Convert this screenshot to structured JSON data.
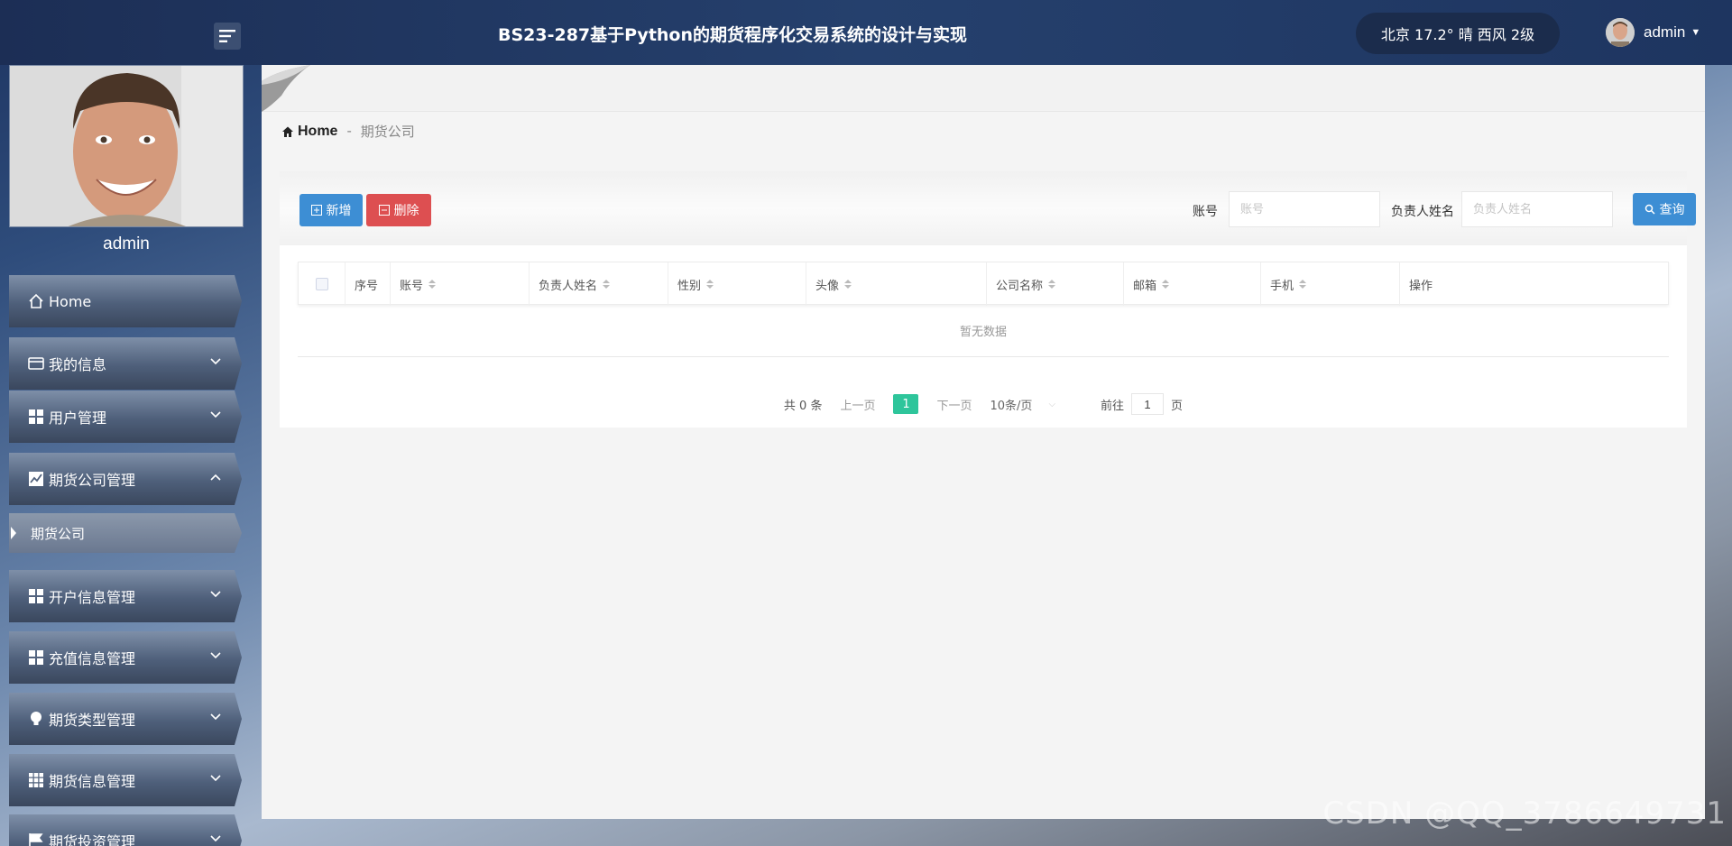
{
  "header": {
    "title": "BS23-287基于Python的期货程序化交易系统的设计与实现",
    "weather": "北京 17.2° 晴 西风 2级",
    "username": "admin"
  },
  "sidebar": {
    "profile_name": "admin",
    "items": [
      {
        "label": "Home",
        "icon": "home-icon"
      },
      {
        "label": "我的信息",
        "icon": "id-card-icon"
      },
      {
        "label": "用户管理",
        "icon": "grid-icon"
      },
      {
        "label": "期货公司管理",
        "icon": "chart-icon",
        "expanded": true
      },
      {
        "label": "开户信息管理",
        "icon": "grid-icon"
      },
      {
        "label": "充值信息管理",
        "icon": "grid-icon"
      },
      {
        "label": "期货类型管理",
        "icon": "bulb-icon"
      },
      {
        "label": "期货信息管理",
        "icon": "apps-icon"
      },
      {
        "label": "期货投资管理",
        "icon": "flag-icon"
      }
    ],
    "active_sub": "期货公司"
  },
  "breadcrumb": {
    "home": "Home",
    "separator": "-",
    "current": "期货公司"
  },
  "toolbar": {
    "add_label": "新增",
    "delete_label": "删除",
    "search_label": "查询",
    "fields": [
      {
        "label": "账号",
        "placeholder": "账号"
      },
      {
        "label": "负责人姓名",
        "placeholder": "负责人姓名"
      }
    ]
  },
  "table": {
    "columns": [
      "序号",
      "账号",
      "负责人姓名",
      "性别",
      "头像",
      "公司名称",
      "邮箱",
      "手机",
      "操作"
    ],
    "empty_text": "暂无数据"
  },
  "pagination": {
    "total": "共 0 条",
    "prev": "上一页",
    "current": "1",
    "next": "下一页",
    "page_size": "10条/页",
    "goto_label": "前往",
    "goto_value": "1",
    "goto_suffix": "页"
  },
  "watermark": "CSDN @QQ_3786649731",
  "colors": {
    "header_bg": "#25406d",
    "primary": "#3d8ed4",
    "danger": "#dd4f51",
    "page_active": "#2ec59b"
  }
}
